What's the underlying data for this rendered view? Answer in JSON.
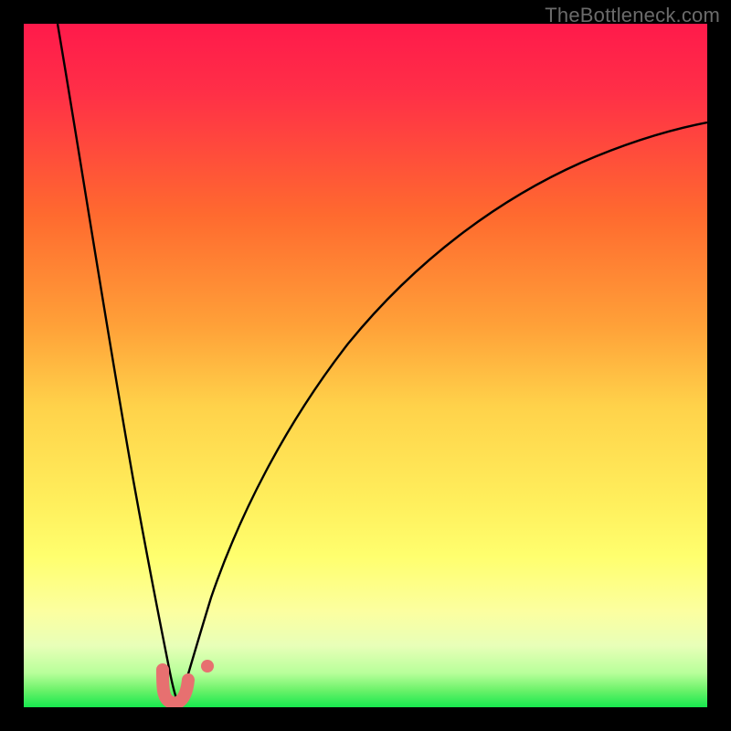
{
  "watermark": {
    "text": "TheBottleneck.com"
  },
  "colors": {
    "black": "#000000",
    "curve": "#000000",
    "marker": "#e77070",
    "grad_top": "#ff1a4b",
    "grad_mid1": "#ff6a2f",
    "grad_mid2": "#ffd24a",
    "grad_yellow": "#ffff6e",
    "grad_pale": "#f6ffb2",
    "grad_green": "#17e84e"
  },
  "chart_data": {
    "type": "line",
    "title": "",
    "xlabel": "",
    "ylabel": "",
    "xlim": [
      0,
      100
    ],
    "ylim": [
      0,
      100
    ],
    "series": [
      {
        "name": "left-branch",
        "x": [
          5,
          7,
          9,
          11,
          13,
          15,
          17,
          18.5,
          20,
          21,
          22
        ],
        "y": [
          100,
          82,
          65,
          50,
          37,
          25,
          15,
          8,
          3,
          1,
          0
        ]
      },
      {
        "name": "right-branch",
        "x": [
          22,
          24,
          27,
          31,
          36,
          42,
          50,
          60,
          72,
          86,
          100
        ],
        "y": [
          0,
          5,
          13,
          24,
          36,
          48,
          59,
          68,
          76,
          82,
          86
        ]
      }
    ],
    "markers": [
      {
        "name": "u-marker-left",
        "x": 20.5,
        "y": 3
      },
      {
        "name": "u-marker-bottom",
        "x": 21.5,
        "y": 0.5
      },
      {
        "name": "u-marker-right",
        "x": 23,
        "y": 3
      },
      {
        "name": "dot-marker",
        "x": 26,
        "y": 5
      }
    ],
    "gradient_stops": [
      {
        "pos": 0.0,
        "color": "#ff1a4b"
      },
      {
        "pos": 0.28,
        "color": "#ff6a2f"
      },
      {
        "pos": 0.56,
        "color": "#ffd24a"
      },
      {
        "pos": 0.78,
        "color": "#ffff6e"
      },
      {
        "pos": 0.9,
        "color": "#f6ffb2"
      },
      {
        "pos": 1.0,
        "color": "#17e84e"
      }
    ]
  }
}
